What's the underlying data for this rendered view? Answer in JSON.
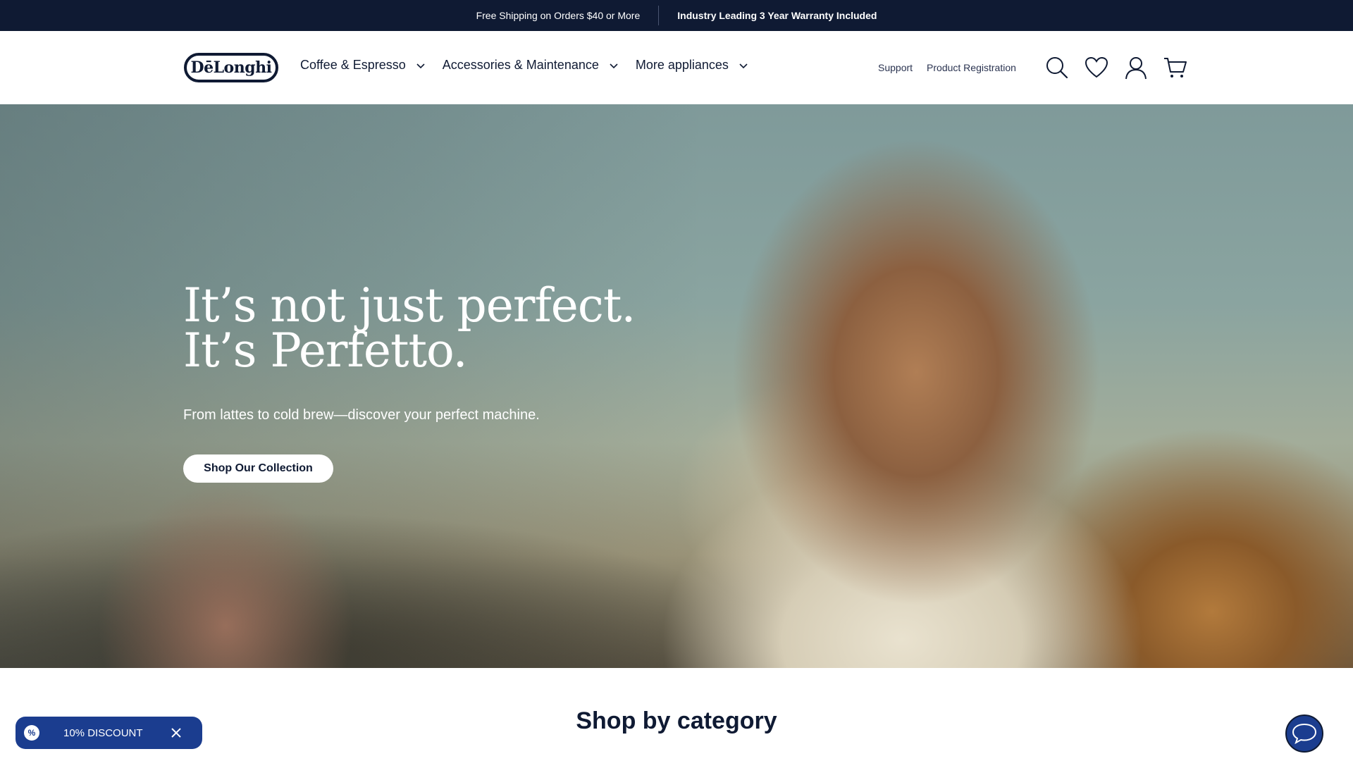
{
  "announcement": {
    "shipping": "Free Shipping on Orders $40 or More",
    "warranty": "Industry Leading 3 Year Warranty Included"
  },
  "header": {
    "logo_text": "DēLonghi",
    "nav": [
      {
        "label": "Coffee & Espresso",
        "icon": "chevron-down-icon"
      },
      {
        "label": "Accessories & Maintenance",
        "icon": "chevron-down-icon"
      },
      {
        "label": "More appliances",
        "icon": "chevron-down-icon"
      }
    ],
    "utility_links": {
      "support": "Support",
      "product_registration": "Product Registration"
    },
    "icons": [
      "search-icon",
      "heart-icon",
      "user-icon",
      "cart-icon"
    ]
  },
  "hero": {
    "headline_line1": "It’s not just perfect.",
    "headline_line2": "It’s Perfetto.",
    "subtitle": "From lattes to cold brew—discover your perfect machine.",
    "cta_label": "Shop Our Collection"
  },
  "section": {
    "title": "Shop by category"
  },
  "discount_popup": {
    "badge": "%",
    "label": "10% DISCOUNT",
    "close_icon": "close-icon"
  },
  "chat": {
    "icon": "chat-bubble-icon"
  },
  "colors": {
    "navy": "#0f1a33",
    "brand_blue": "#1b3d8f",
    "white": "#ffffff"
  }
}
